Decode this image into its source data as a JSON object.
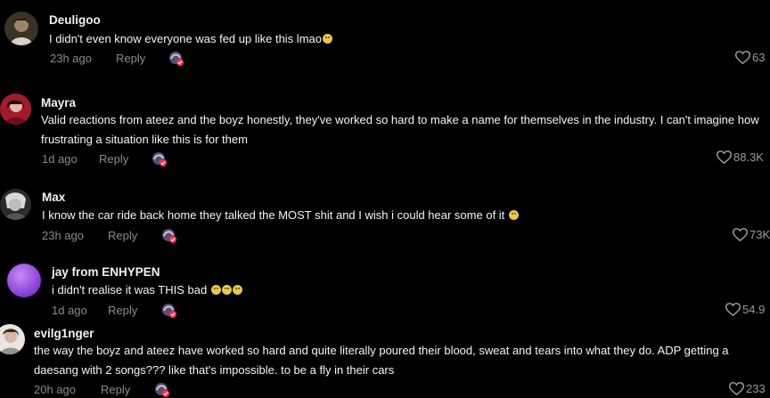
{
  "colors": {
    "background": "#000000",
    "text": "#f5f5f5",
    "meta": "#8a8a8a",
    "badge_accent": "#ff2d55"
  },
  "comments": [
    {
      "username": "Deuligoo",
      "text": "I didn't even know everyone was fed up like this lmao",
      "emojis": 1,
      "time": "23h ago",
      "reply_label": "Reply",
      "likes": "63",
      "avatar_icon": "user-avatar-icon"
    },
    {
      "username": "Mayra",
      "text": "Valid reactions from ateez and the boyz honestly, they've worked so hard to make a name for themselves in the industry. I can't imagine how frustrating a situation like this is for them",
      "emojis": 0,
      "time": "1d ago",
      "reply_label": "Reply",
      "likes": "88.3K",
      "avatar_icon": "user-avatar-icon"
    },
    {
      "username": "Max",
      "text": "I know the car ride back home they talked the MOST shit and I wish i could hear some of it",
      "emojis": 1,
      "time": "23h ago",
      "reply_label": "Reply",
      "likes": "73K",
      "avatar_icon": "user-avatar-icon"
    },
    {
      "username": "jay from ENHYPEN",
      "text": "i didn't realise it was THIS bad",
      "emojis": 3,
      "time": "1d ago",
      "reply_label": "Reply",
      "likes": "54.9",
      "avatar_icon": "user-avatar-icon"
    },
    {
      "username": "evilg1nger",
      "text": "the way the boyz and ateez have worked so hard and quite literally poured their blood, sweat and tears into what they do. ADP getting a daesang with 2 songs??? like that's impossible. to be a fly in their cars",
      "emojis": 0,
      "time": "20h ago",
      "reply_label": "Reply",
      "likes": "233",
      "avatar_icon": "user-avatar-icon"
    }
  ]
}
